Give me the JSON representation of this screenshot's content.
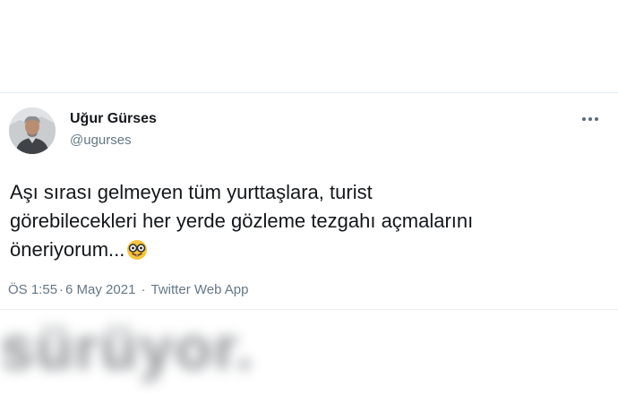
{
  "tweet": {
    "author_name": "Uğur Gürses",
    "author_handle": "@ugurses",
    "text_lines": [
      "Aşı sırası gelmeyen tüm yurttaşlara, turist",
      "görebilecekleri her yerde gözleme tezgahı açmalarını",
      "öneriyorum..."
    ],
    "emoji": "nerd-face",
    "time": "ÖS 1:55",
    "date": "6 May 2021",
    "separator": "·",
    "source": "Twitter Web App"
  },
  "background_text": "sürüyor.",
  "colors": {
    "text_primary": "#14171a",
    "text_secondary": "#657786",
    "divider": "#e6ecf0",
    "emoji_yellow": "#f7c53a"
  }
}
